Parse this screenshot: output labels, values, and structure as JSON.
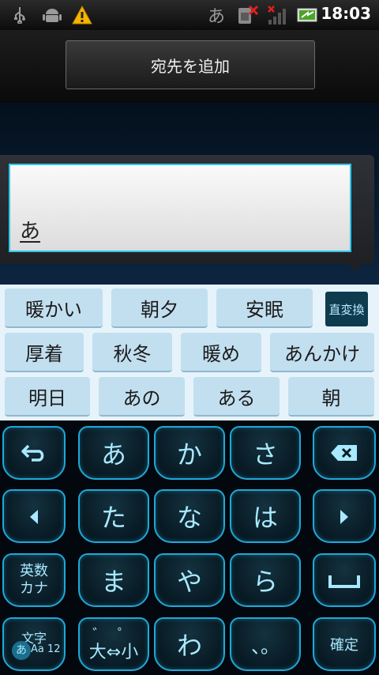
{
  "status_bar": {
    "icons": [
      "usb-icon",
      "android-debug-icon",
      "warning-icon",
      "input-method-hiragana",
      "sim-error-icon",
      "signal-none-icon",
      "battery-charging-icon"
    ],
    "ime_indicator": "あ",
    "time": "18:03",
    "warning_color": "#f5b400"
  },
  "header": {
    "add_recipient_label": "宛先を追加"
  },
  "composer": {
    "text": "あ"
  },
  "candidates": {
    "row1": [
      "暖かい",
      "朝夕",
      "安眠"
    ],
    "direct_convert_label": "直変換",
    "row2": [
      "厚着",
      "秋冬",
      "暖め",
      "あんかけ"
    ],
    "row3": [
      "明日",
      "あの",
      "ある",
      "朝"
    ]
  },
  "keyboard": {
    "row1": [
      "⮌",
      "あ",
      "か",
      "さ",
      "⌫"
    ],
    "row2": [
      "◂",
      "た",
      "な",
      "は",
      "▸"
    ],
    "row3": {
      "mode": [
        "英数",
        "カナ"
      ],
      "keys": [
        "ま",
        "や",
        "ら"
      ],
      "space_icon": "space-icon"
    },
    "row4": {
      "mode_top": "文字",
      "mode_bottom": "Aa 12",
      "mode_hira": "あ",
      "dakuten_top": "゛ ゜",
      "dakuten_bottom": "大⇔小",
      "wa": "わ",
      "punct": "、。",
      "confirm": "確定"
    }
  },
  "colors": {
    "key_border": "#1fa8d8",
    "candidate_bg": "#c2dff0",
    "composer_border": "#2ec6ee"
  }
}
